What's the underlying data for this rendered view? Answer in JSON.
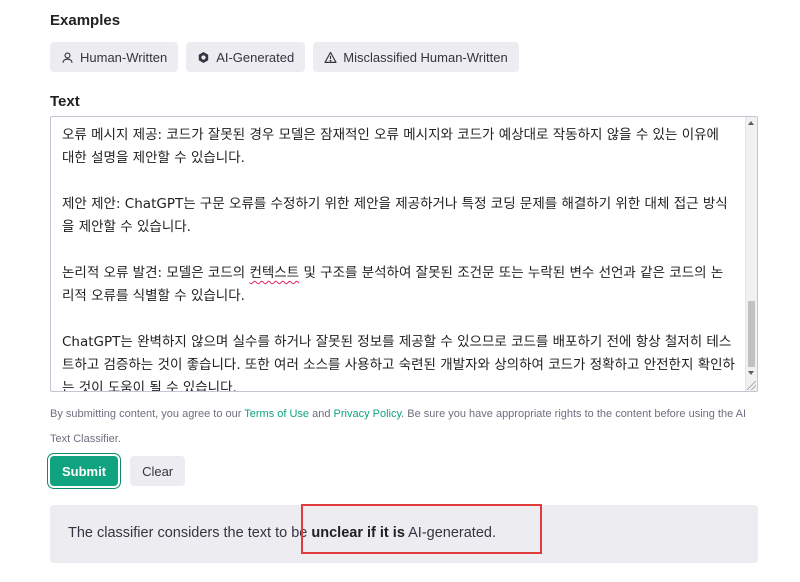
{
  "examples": {
    "heading": "Examples",
    "buttons": [
      {
        "label": "Human-Written",
        "icon": "user-icon"
      },
      {
        "label": "AI-Generated",
        "icon": "openai-logo-icon"
      },
      {
        "label": "Misclassified Human-Written",
        "icon": "warning-triangle-icon"
      }
    ]
  },
  "text_section": {
    "heading": "Text",
    "paragraphs": [
      "오류 메시지 제공: 코드가 잘못된 경우 모델은 잠재적인 오류 메시지와 코드가 예상대로 작동하지 않을 수 있는 이유에 대한 설명을 제안할 수 있습니다.",
      "제안 제안: ChatGPT는 구문 오류를 수정하기 위한 제안을 제공하거나 특정 코딩 문제를 해결하기 위한 대체 접근 방식을 제안할 수 있습니다.",
      "논리적 오류 발견: 모델은 코드의 ",
      "ChatGPT는 완벽하지 않으며 실수를 하거나 잘못된 정보를 제공할 수 있으므로 코드를 배포하기 전에 항상 철저히 테스트하고 검증하는 것이 좋습니다. 또한 여러 소스를 사용하고 숙련된 개발자와 상의하여 코드가 정확하고 안전한지 확인하는 것이 도움이 될 수 있습니다."
    ],
    "p3_word": "컨텍스트",
    "p3_rest": " 및 구조를 분석하여 잘못된 조건문 또는 누락된 변수 선언과 같은 코드의 논리적 오류를 식별할 수 있습니다."
  },
  "disclaimer": {
    "prefix": "By submitting content, you agree to our ",
    "terms_link": "Terms of Use",
    "and": " and ",
    "privacy_link": "Privacy Policy",
    "suffix": ". Be sure you have appropriate rights to the content before using the AI Text Classifier."
  },
  "actions": {
    "submit_label": "Submit",
    "clear_label": "Clear"
  },
  "result": {
    "prefix": "The classifier considers the text to be ",
    "verdict": "unclear if it is",
    "suffix": " AI-generated."
  },
  "colors": {
    "accent": "#10a37f",
    "highlight": "#e03c3c"
  }
}
